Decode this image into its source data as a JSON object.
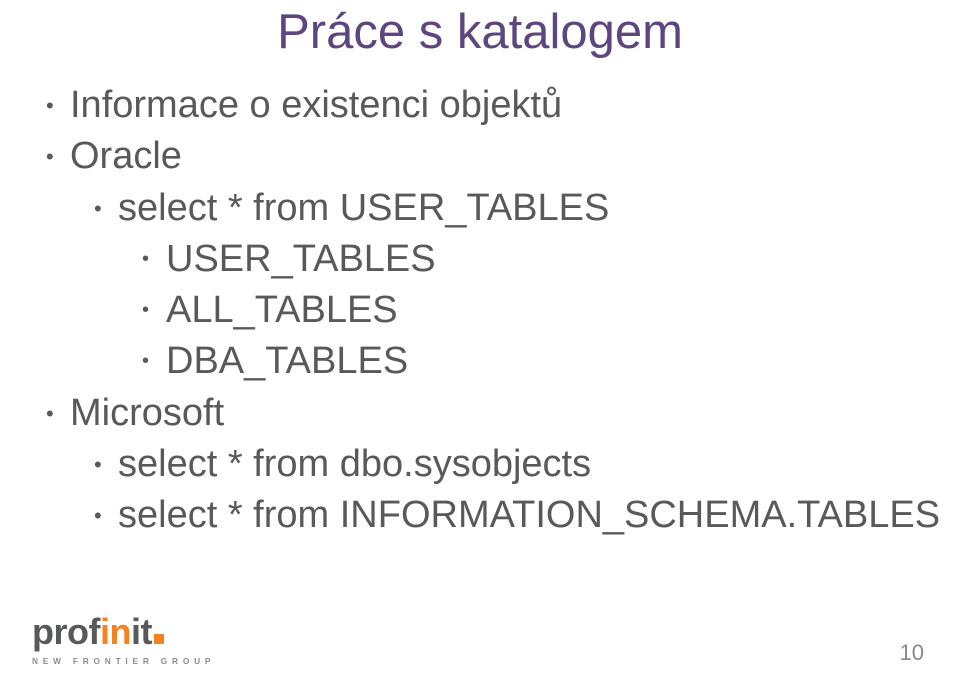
{
  "title": "Práce s katalogem",
  "items": {
    "l1a": "Informace o existenci objektů",
    "l1b": "Oracle",
    "l2a": "select * from USER_TABLES",
    "l3a": "USER_TABLES",
    "l3b": "ALL_TABLES",
    "l3c": "DBA_TABLES",
    "l1c": "Microsoft",
    "l2b": "select * from dbo.sysobjects",
    "l2c": "select * from INFORMATION_SCHEMA.TABLES"
  },
  "logo": {
    "part1": "prof",
    "part2": "in",
    "part3": "it",
    "tagline": "NEW FRONTIER GROUP"
  },
  "page": "10"
}
